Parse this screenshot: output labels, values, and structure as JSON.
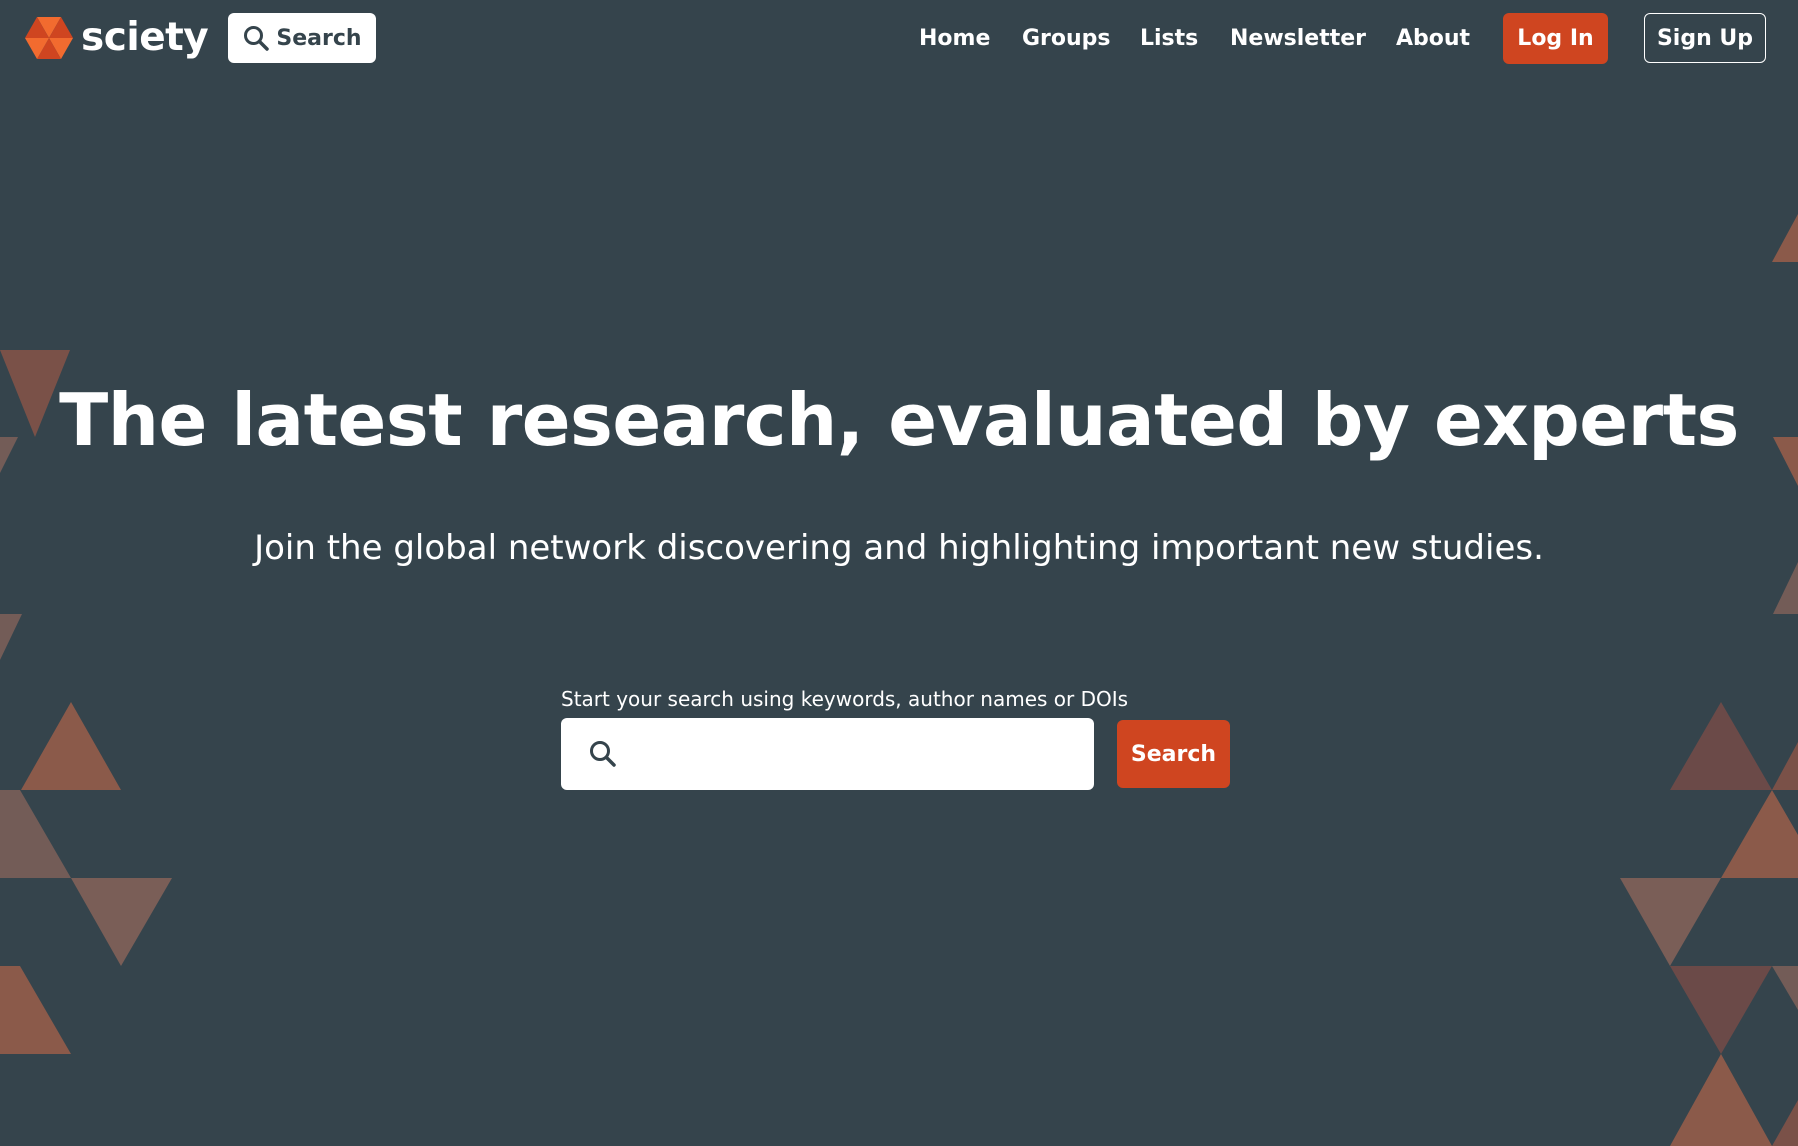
{
  "brand": {
    "name": "sciety",
    "logo_icon": "sciety-hexagon-logo-icon"
  },
  "header": {
    "search_label": "Search",
    "search_icon": "search-icon",
    "nav": {
      "home": "Home",
      "groups": "Groups",
      "lists": "Lists",
      "newsletter": "Newsletter",
      "about": "About"
    },
    "login_label": "Log In",
    "signup_label": "Sign Up"
  },
  "hero": {
    "title": "The latest research, evaluated by experts",
    "subtitle": "Join the global network discovering and highlighting important new studies."
  },
  "search": {
    "label": "Start your search using keywords, author names or DOIs",
    "value": "",
    "button_label": "Search",
    "icon": "search-icon"
  },
  "colors": {
    "background": "#35444c",
    "accent": "#cf4520",
    "text": "#ffffff",
    "decoration_triangles": [
      "#7a5148",
      "#8b5a4a",
      "#735c57",
      "#6b4a48",
      "#9a6652"
    ]
  }
}
